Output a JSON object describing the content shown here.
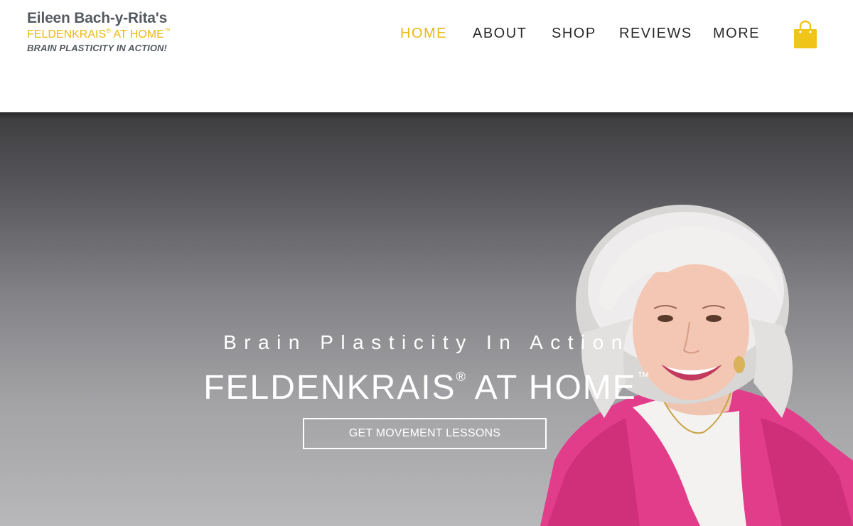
{
  "logo": {
    "name": "Eileen Bach-y-Rita's",
    "brand_main": "FELDENKRAIS",
    "brand_reg": "®",
    "brand_rest": "AT HOME",
    "brand_tm": "™",
    "tagline": "BRAIN PLASTICITY IN ACTION!"
  },
  "nav": {
    "home": "HOME",
    "about": "ABOUT",
    "shop": "SHOP",
    "reviews": "REVIEWS",
    "more": "MORE",
    "active": "HOME"
  },
  "cart": {
    "icon": "shopping-bag-icon",
    "count": "0",
    "color": "#f0c419"
  },
  "hero": {
    "tagline": "Brain Plasticity In Action",
    "title_main": "FELDENKRAIS",
    "title_reg": "®",
    "title_rest": "AT HOME",
    "title_tm": "™",
    "cta_label": "GET MOVEMENT LESSONS"
  },
  "colors": {
    "accent": "#e9b913",
    "nav_text": "#2a2a2a",
    "logo_gray": "#555a60"
  }
}
